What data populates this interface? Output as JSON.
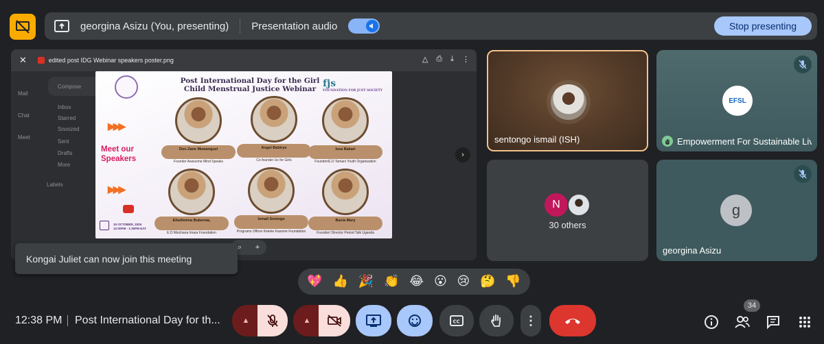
{
  "top_bar": {
    "presenting_title": "georgina Asizu (You, presenting)",
    "audio_label": "Presentation audio",
    "stop_label": "Stop presenting"
  },
  "presentation": {
    "file_name": "edited post IDG Webinar speakers poster.png",
    "poster_title_line1": "Post International Day for the Girl",
    "poster_title_line2": "Child Menstrual Justice Webinar",
    "poster_meet_1": "Meet our",
    "poster_meet_2": "Speakers",
    "poster_logo_right": "fjs",
    "poster_logo_right_sub": "FOUNDATION FOR JUST SOCIETY",
    "poster_date": "15 OCTOBER, 2025",
    "poster_time": "12:00PM - 1:30PM EAT",
    "arrows": "▶▶▶",
    "speakers": [
      {
        "name": "Don Zane Muwanguzi",
        "role": "Founder Awesome Mind Speaks"
      },
      {
        "name": "Angel Babirye",
        "role": "Co-founder Us for Girls"
      },
      {
        "name": "Issa Bakari",
        "role": "Founder/E.D Tamani Youth Organization"
      },
      {
        "name": "Eliwilimina Buberwa,",
        "role": "E.D Msichana Imara Foundation"
      },
      {
        "name": "Ismail Sentogo",
        "role": "Programs Officer Keleke Kasome Foundation"
      },
      {
        "name": "Bacia Mary",
        "role": "Founder/ Director Period Talk Uganda"
      }
    ],
    "gmail_items": [
      "Compose",
      "Inbox",
      "Starred",
      "Snoozed",
      "Sent",
      "Drafts",
      "More",
      "Labels"
    ],
    "gmail_rail": [
      "Mail",
      "Chat",
      "Meet"
    ]
  },
  "toast": {
    "message": "Kongai Juliet can now join this meeting"
  },
  "participants": {
    "ismail": "sentongo ismail (ISH)",
    "empowerment": "Empowerment For Sustainable Liv...",
    "empowerment_logo": "EFSL",
    "others_initial": "N",
    "others_label": "30 others",
    "georgina_initial": "g",
    "georgina": "georgina Asizu"
  },
  "reactions": [
    "💖",
    "👍",
    "🎉",
    "👏",
    "😂",
    "😮",
    "😢",
    "🤔",
    "👎"
  ],
  "bottom_bar": {
    "time": "12:38 PM",
    "meeting_title": "Post International Day for th...",
    "people_count": "34"
  },
  "colors": {
    "background": "#202124",
    "accent_blue": "#a8c7fa",
    "leave_red": "#dc362e",
    "warning_yellow": "#f9ab00"
  },
  "icons": [
    "presenting-off-icon",
    "screen-share-icon",
    "volume-icon",
    "mic-off-icon",
    "camera-off-icon",
    "present-screen-icon",
    "emoji-icon",
    "captions-icon",
    "raise-hand-icon",
    "more-vert-icon",
    "call-end-icon",
    "info-icon",
    "people-icon",
    "chat-icon",
    "apps-icon"
  ]
}
